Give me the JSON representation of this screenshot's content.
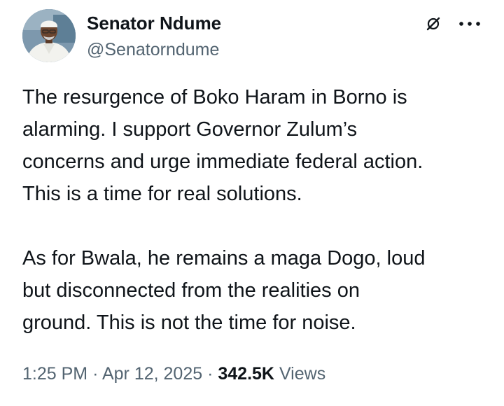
{
  "author": {
    "name": "Senator Ndume",
    "handle": "@Senatorndume",
    "avatar_icon": "profile-photo"
  },
  "header_actions": {
    "grok_icon": "grok-icon",
    "more_icon": "more-options-icon"
  },
  "tweet": {
    "paragraph1": "The resurgence of Boko Haram in Borno is\nalarming. I support Governor Zulum’s\nconcerns and urge immediate federal action.\nThis is a time for real solutions.",
    "paragraph2": "As for Bwala, he remains a maga Dogo, loud\nbut disconnected from the realities on\nground. This is not the time for noise."
  },
  "meta": {
    "time": "1:25 PM",
    "separator1": "·",
    "date": "Apr 12, 2025",
    "separator2": "·",
    "views_count": "342.5K",
    "views_label": "Views"
  },
  "colors": {
    "text_primary": "#0f1419",
    "text_secondary": "#536471",
    "background": "#ffffff"
  }
}
